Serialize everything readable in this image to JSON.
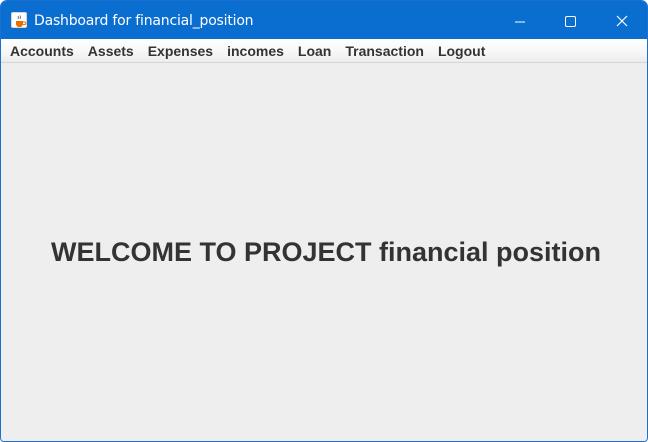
{
  "window": {
    "title": "Dashboard for financial_position",
    "app_icon": "java-cup-icon",
    "controls": [
      "minimize-icon",
      "maximize-icon",
      "close-icon"
    ]
  },
  "menubar": {
    "items": [
      {
        "label": "Accounts"
      },
      {
        "label": "Assets"
      },
      {
        "label": "Expenses"
      },
      {
        "label": "incomes"
      },
      {
        "label": "Loan"
      },
      {
        "label": "Transaction"
      },
      {
        "label": "Logout"
      }
    ]
  },
  "main": {
    "welcome_text": "WELCOME TO PROJECT financial position"
  },
  "colors": {
    "titlebar": "#0a6ed1",
    "content_bg": "#eeeeee",
    "text": "#333333"
  }
}
